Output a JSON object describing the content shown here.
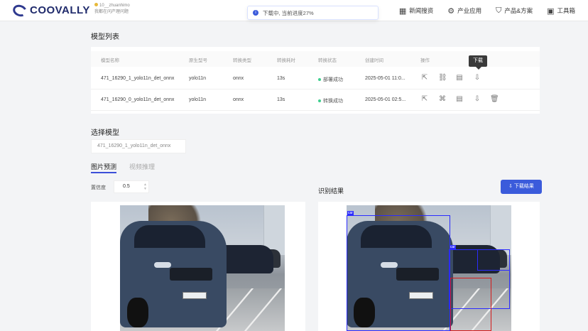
{
  "header": {
    "logo_text": "COOVALLY",
    "user_line1": "10__zhuanhimo",
    "user_line2": "我都在问产理问题",
    "nav": [
      {
        "icon": "news-icon",
        "glyph": "▦",
        "label": "新闻搜资"
      },
      {
        "icon": "industry-icon",
        "glyph": "⚙",
        "label": "产业应用"
      },
      {
        "icon": "shield-icon",
        "glyph": "⛉",
        "label": "产品&方案"
      },
      {
        "icon": "toolbox-icon",
        "glyph": "▣",
        "label": "工具箱"
      }
    ]
  },
  "toast": {
    "icon": "info-icon",
    "text": "下载中, 当前进度27%"
  },
  "model_list": {
    "title": "模型列表",
    "columns": [
      "模型名称",
      "原生型号",
      "转换类型",
      "转换耗时",
      "转换状态",
      "创建时间",
      "操作"
    ],
    "rows": [
      {
        "name": "471_16290_1_yolo11n_det_onnx",
        "model": "yolo11n",
        "type": "onnx",
        "time": "13s",
        "status": "部署成功",
        "created": "2025-05-01 11:0..."
      },
      {
        "name": "471_16290_0_yolo11n_det_onnx",
        "model": "yolo11n",
        "type": "onnx",
        "time": "13s",
        "status": "转换成功",
        "created": "2025-05-01 02:5..."
      }
    ],
    "tooltip": "下载"
  },
  "select_model": {
    "title": "选择模型",
    "value": "471_16290_1_yolo11n_det_onnx"
  },
  "tabs": [
    {
      "label": "图片预测",
      "active": true
    },
    {
      "label": "视频推理",
      "active": false
    }
  ],
  "confidence": {
    "label": "置信度",
    "value": "0.5"
  },
  "result": {
    "title": "识别结果",
    "download_label": "⇩ 下载结果"
  },
  "colors": {
    "accent": "#3b5bdb",
    "box_blue": "#2b2bff",
    "box_red": "#d41a1a",
    "success": "#3ecf8e"
  }
}
